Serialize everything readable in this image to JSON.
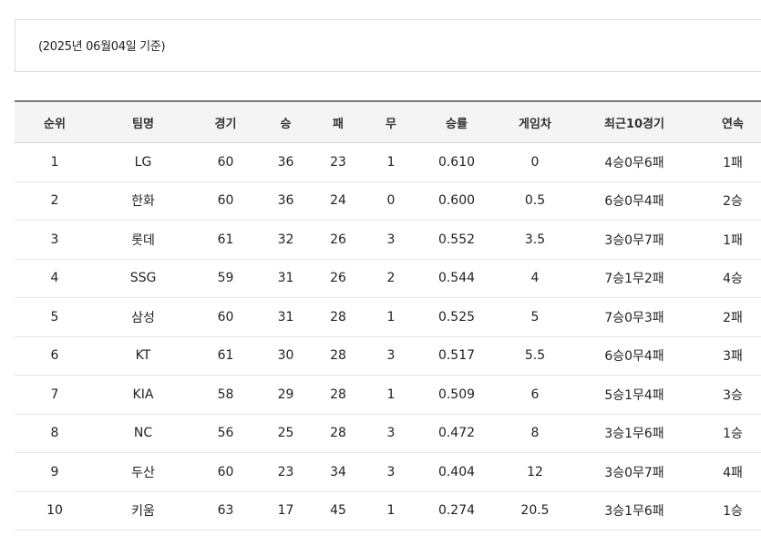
{
  "date_label": "(2025년 06월04일 기준)",
  "columns": [
    "순위",
    "팀명",
    "경기",
    "승",
    "패",
    "무",
    "승률",
    "게임차",
    "최근10경기",
    "연속"
  ],
  "rows": [
    [
      "1",
      "LG",
      "60",
      "36",
      "23",
      "1",
      "0.610",
      "0",
      "4승0무6패",
      "1패"
    ],
    [
      "2",
      "한화",
      "60",
      "36",
      "24",
      "0",
      "0.600",
      "0.5",
      "6승0무4패",
      "2승"
    ],
    [
      "3",
      "롯데",
      "61",
      "32",
      "26",
      "3",
      "0.552",
      "3.5",
      "3승0무7패",
      "1패"
    ],
    [
      "4",
      "SSG",
      "59",
      "31",
      "26",
      "2",
      "0.544",
      "4",
      "7승1무2패",
      "4승"
    ],
    [
      "5",
      "삼성",
      "60",
      "31",
      "28",
      "1",
      "0.525",
      "5",
      "7승0무3패",
      "2패"
    ],
    [
      "6",
      "KT",
      "61",
      "30",
      "28",
      "3",
      "0.517",
      "5.5",
      "6승0무4패",
      "3패"
    ],
    [
      "7",
      "KIA",
      "58",
      "29",
      "28",
      "1",
      "0.509",
      "6",
      "5승1무4패",
      "3승"
    ],
    [
      "8",
      "NC",
      "56",
      "25",
      "28",
      "3",
      "0.472",
      "8",
      "3승1무6패",
      "1승"
    ],
    [
      "9",
      "두산",
      "60",
      "23",
      "34",
      "3",
      "0.404",
      "12",
      "3승0무7패",
      "4패"
    ],
    [
      "10",
      "키움",
      "63",
      "17",
      "45",
      "1",
      "0.274",
      "20.5",
      "3승1무6패",
      "1승"
    ]
  ]
}
